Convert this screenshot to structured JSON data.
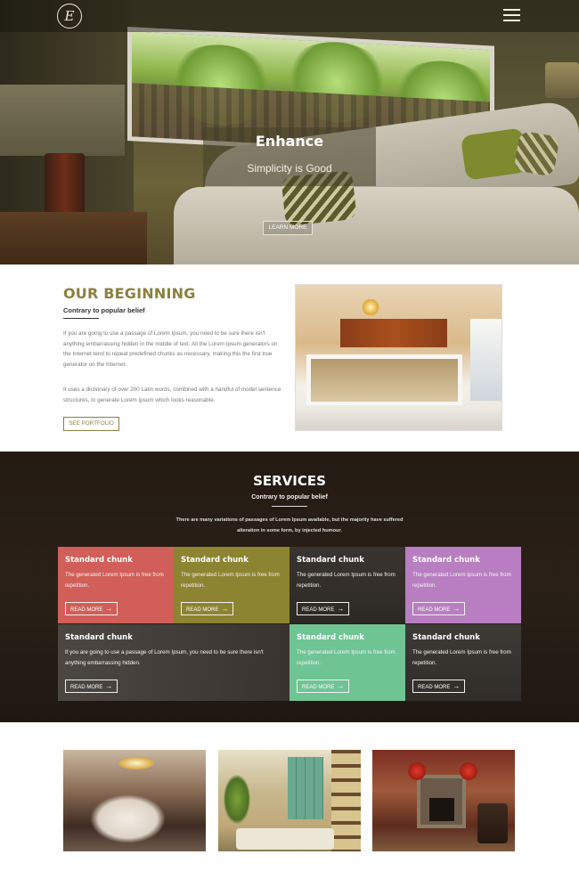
{
  "header": {
    "logo_letter": "E",
    "logo_icon": "script-e-monogram-logo",
    "menu_icon": "hamburger-icon"
  },
  "hero": {
    "title": "Enhance",
    "subtitle": "Simplicity is Good",
    "cta_label": "LEARN MORE"
  },
  "beginning": {
    "title": "OUR BEGINNING",
    "subtitle": "Contrary to popular belief",
    "paragraph1": "If you are going to use a passage of Lorem Ipsum, you need to be sure there isn't anything embarrassing hidden in the middle of text. All the Lorem Ipsum generators on the Internet tend to repeat predefined chunks as necessary, making this the first true generator on the Internet.",
    "paragraph2": "It uses a dictionary of over 200 Latin words, combined with a handful of model sentence structures, to generate Lorem Ipsum which looks reasonable.",
    "button_label": "SEE PORTFOLIO"
  },
  "services": {
    "title": "SERVICES",
    "subtitle": "Contrary to popular belief",
    "description": "There are many variations of passages of Lorem Ipsum available, but the majority have suffered alteration in some form, by injected humour.",
    "cards": [
      {
        "title": "Standard chunk",
        "text": "The generated Lorem Ipsum is free from repetition.",
        "button": "READ MORE",
        "color": "#d15e58"
      },
      {
        "title": "Standard chunk",
        "text": "The generated Lorem Ipsum is free from repetition.",
        "button": "READ MORE",
        "color": "#8c8431"
      },
      {
        "title": "Standard chunk",
        "text": "The generated Lorem Ipsum is free from repetition.",
        "button": "READ MORE",
        "color": "#3c3834"
      },
      {
        "title": "Standard chunk",
        "text": "The generated Lorem Ipsum is free from repetition.",
        "button": "READ MORE",
        "color": "#b87ec1"
      },
      {
        "title": "Standard chunk",
        "text": "If you are going to use a passage of Lorem Ipsum, you need to be sure there isn't anything embarrassing hidden.",
        "button": "READ MORE",
        "color": "#504c48"
      },
      {
        "title": "Standard chunk",
        "text": "The generated Lorem Ipsum is free from repetition.",
        "button": "READ MORE",
        "color": "#6fc494"
      },
      {
        "title": "Standard chunk",
        "text": "The generated Lorem Ipsum is free from repetition.",
        "button": "READ MORE",
        "color": "#413e3a"
      }
    ],
    "arrow_icon": "arrow-right-icon"
  },
  "gallery": {
    "images": [
      "dining-room-photo",
      "living-room-bookshelf-photo",
      "fireplace-room-photo"
    ]
  }
}
